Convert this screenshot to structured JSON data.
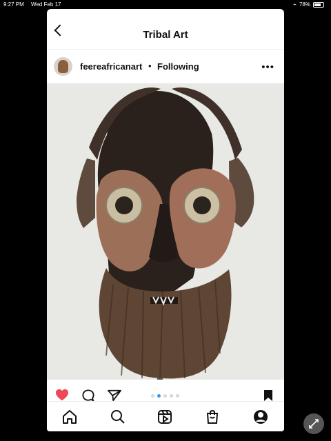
{
  "status_bar": {
    "time": "9:27 PM",
    "date": "Wed Feb 17",
    "battery_percent": "78%",
    "battery_level": 0.78
  },
  "header": {
    "title": "Tribal Art"
  },
  "post": {
    "username": "feereafricanart",
    "separator": "•",
    "follow_status": "Following",
    "carousel": {
      "count": 5,
      "active_index": 1
    }
  },
  "icons": {
    "back": "chevron-left-icon",
    "more": "more-horizontal-icon",
    "like": "heart-icon",
    "comment": "comment-icon",
    "share": "send-icon",
    "save": "bookmark-icon",
    "home": "home-icon",
    "search": "search-icon",
    "reels": "reels-icon",
    "shop": "shopping-bag-icon",
    "profile": "profile-icon",
    "float": "collapse-icon"
  },
  "colors": {
    "like_red": "#ed4956",
    "dot_active": "#3897f0",
    "dot_inactive": "#d8d8d8",
    "black": "#111111"
  }
}
